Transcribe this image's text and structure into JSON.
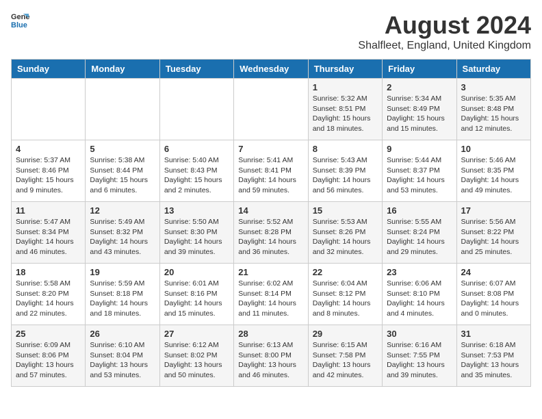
{
  "header": {
    "logo_general": "General",
    "logo_blue": "Blue",
    "main_title": "August 2024",
    "sub_title": "Shalfleet, England, United Kingdom"
  },
  "days_of_week": [
    "Sunday",
    "Monday",
    "Tuesday",
    "Wednesday",
    "Thursday",
    "Friday",
    "Saturday"
  ],
  "weeks": [
    [
      {
        "day": "",
        "info": ""
      },
      {
        "day": "",
        "info": ""
      },
      {
        "day": "",
        "info": ""
      },
      {
        "day": "",
        "info": ""
      },
      {
        "day": "1",
        "info": "Sunrise: 5:32 AM\nSunset: 8:51 PM\nDaylight: 15 hours and 18 minutes."
      },
      {
        "day": "2",
        "info": "Sunrise: 5:34 AM\nSunset: 8:49 PM\nDaylight: 15 hours and 15 minutes."
      },
      {
        "day": "3",
        "info": "Sunrise: 5:35 AM\nSunset: 8:48 PM\nDaylight: 15 hours and 12 minutes."
      }
    ],
    [
      {
        "day": "4",
        "info": "Sunrise: 5:37 AM\nSunset: 8:46 PM\nDaylight: 15 hours and 9 minutes."
      },
      {
        "day": "5",
        "info": "Sunrise: 5:38 AM\nSunset: 8:44 PM\nDaylight: 15 hours and 6 minutes."
      },
      {
        "day": "6",
        "info": "Sunrise: 5:40 AM\nSunset: 8:43 PM\nDaylight: 15 hours and 2 minutes."
      },
      {
        "day": "7",
        "info": "Sunrise: 5:41 AM\nSunset: 8:41 PM\nDaylight: 14 hours and 59 minutes."
      },
      {
        "day": "8",
        "info": "Sunrise: 5:43 AM\nSunset: 8:39 PM\nDaylight: 14 hours and 56 minutes."
      },
      {
        "day": "9",
        "info": "Sunrise: 5:44 AM\nSunset: 8:37 PM\nDaylight: 14 hours and 53 minutes."
      },
      {
        "day": "10",
        "info": "Sunrise: 5:46 AM\nSunset: 8:35 PM\nDaylight: 14 hours and 49 minutes."
      }
    ],
    [
      {
        "day": "11",
        "info": "Sunrise: 5:47 AM\nSunset: 8:34 PM\nDaylight: 14 hours and 46 minutes."
      },
      {
        "day": "12",
        "info": "Sunrise: 5:49 AM\nSunset: 8:32 PM\nDaylight: 14 hours and 43 minutes."
      },
      {
        "day": "13",
        "info": "Sunrise: 5:50 AM\nSunset: 8:30 PM\nDaylight: 14 hours and 39 minutes."
      },
      {
        "day": "14",
        "info": "Sunrise: 5:52 AM\nSunset: 8:28 PM\nDaylight: 14 hours and 36 minutes."
      },
      {
        "day": "15",
        "info": "Sunrise: 5:53 AM\nSunset: 8:26 PM\nDaylight: 14 hours and 32 minutes."
      },
      {
        "day": "16",
        "info": "Sunrise: 5:55 AM\nSunset: 8:24 PM\nDaylight: 14 hours and 29 minutes."
      },
      {
        "day": "17",
        "info": "Sunrise: 5:56 AM\nSunset: 8:22 PM\nDaylight: 14 hours and 25 minutes."
      }
    ],
    [
      {
        "day": "18",
        "info": "Sunrise: 5:58 AM\nSunset: 8:20 PM\nDaylight: 14 hours and 22 minutes."
      },
      {
        "day": "19",
        "info": "Sunrise: 5:59 AM\nSunset: 8:18 PM\nDaylight: 14 hours and 18 minutes."
      },
      {
        "day": "20",
        "info": "Sunrise: 6:01 AM\nSunset: 8:16 PM\nDaylight: 14 hours and 15 minutes."
      },
      {
        "day": "21",
        "info": "Sunrise: 6:02 AM\nSunset: 8:14 PM\nDaylight: 14 hours and 11 minutes."
      },
      {
        "day": "22",
        "info": "Sunrise: 6:04 AM\nSunset: 8:12 PM\nDaylight: 14 hours and 8 minutes."
      },
      {
        "day": "23",
        "info": "Sunrise: 6:06 AM\nSunset: 8:10 PM\nDaylight: 14 hours and 4 minutes."
      },
      {
        "day": "24",
        "info": "Sunrise: 6:07 AM\nSunset: 8:08 PM\nDaylight: 14 hours and 0 minutes."
      }
    ],
    [
      {
        "day": "25",
        "info": "Sunrise: 6:09 AM\nSunset: 8:06 PM\nDaylight: 13 hours and 57 minutes."
      },
      {
        "day": "26",
        "info": "Sunrise: 6:10 AM\nSunset: 8:04 PM\nDaylight: 13 hours and 53 minutes."
      },
      {
        "day": "27",
        "info": "Sunrise: 6:12 AM\nSunset: 8:02 PM\nDaylight: 13 hours and 50 minutes."
      },
      {
        "day": "28",
        "info": "Sunrise: 6:13 AM\nSunset: 8:00 PM\nDaylight: 13 hours and 46 minutes."
      },
      {
        "day": "29",
        "info": "Sunrise: 6:15 AM\nSunset: 7:58 PM\nDaylight: 13 hours and 42 minutes."
      },
      {
        "day": "30",
        "info": "Sunrise: 6:16 AM\nSunset: 7:55 PM\nDaylight: 13 hours and 39 minutes."
      },
      {
        "day": "31",
        "info": "Sunrise: 6:18 AM\nSunset: 7:53 PM\nDaylight: 13 hours and 35 minutes."
      }
    ]
  ]
}
